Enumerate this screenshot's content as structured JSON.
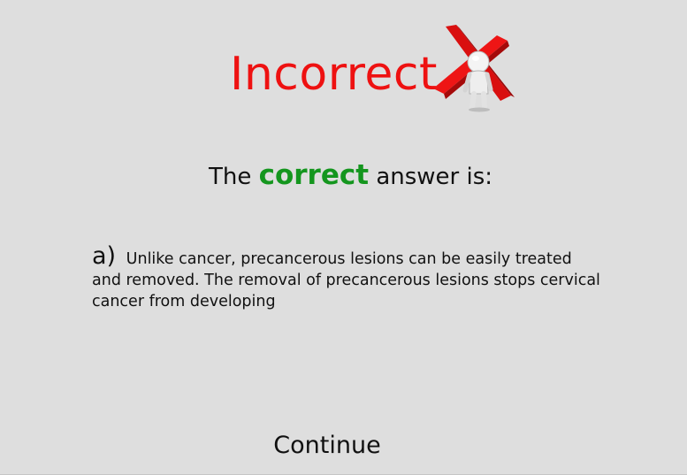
{
  "result": {
    "title": "Incorrect",
    "icon": "red-x-with-person-icon",
    "color": "#ee1111"
  },
  "prompt": {
    "prefix": "The",
    "highlight": "correct",
    "suffix": "answer is:",
    "highlight_color": "#14961e"
  },
  "answer": {
    "letter": "a)",
    "text": "Unlike cancer, precancerous lesions can be easily treated and removed. The removal of precancerous lesions stops cervical cancer from developing"
  },
  "continue_label": "Continue"
}
